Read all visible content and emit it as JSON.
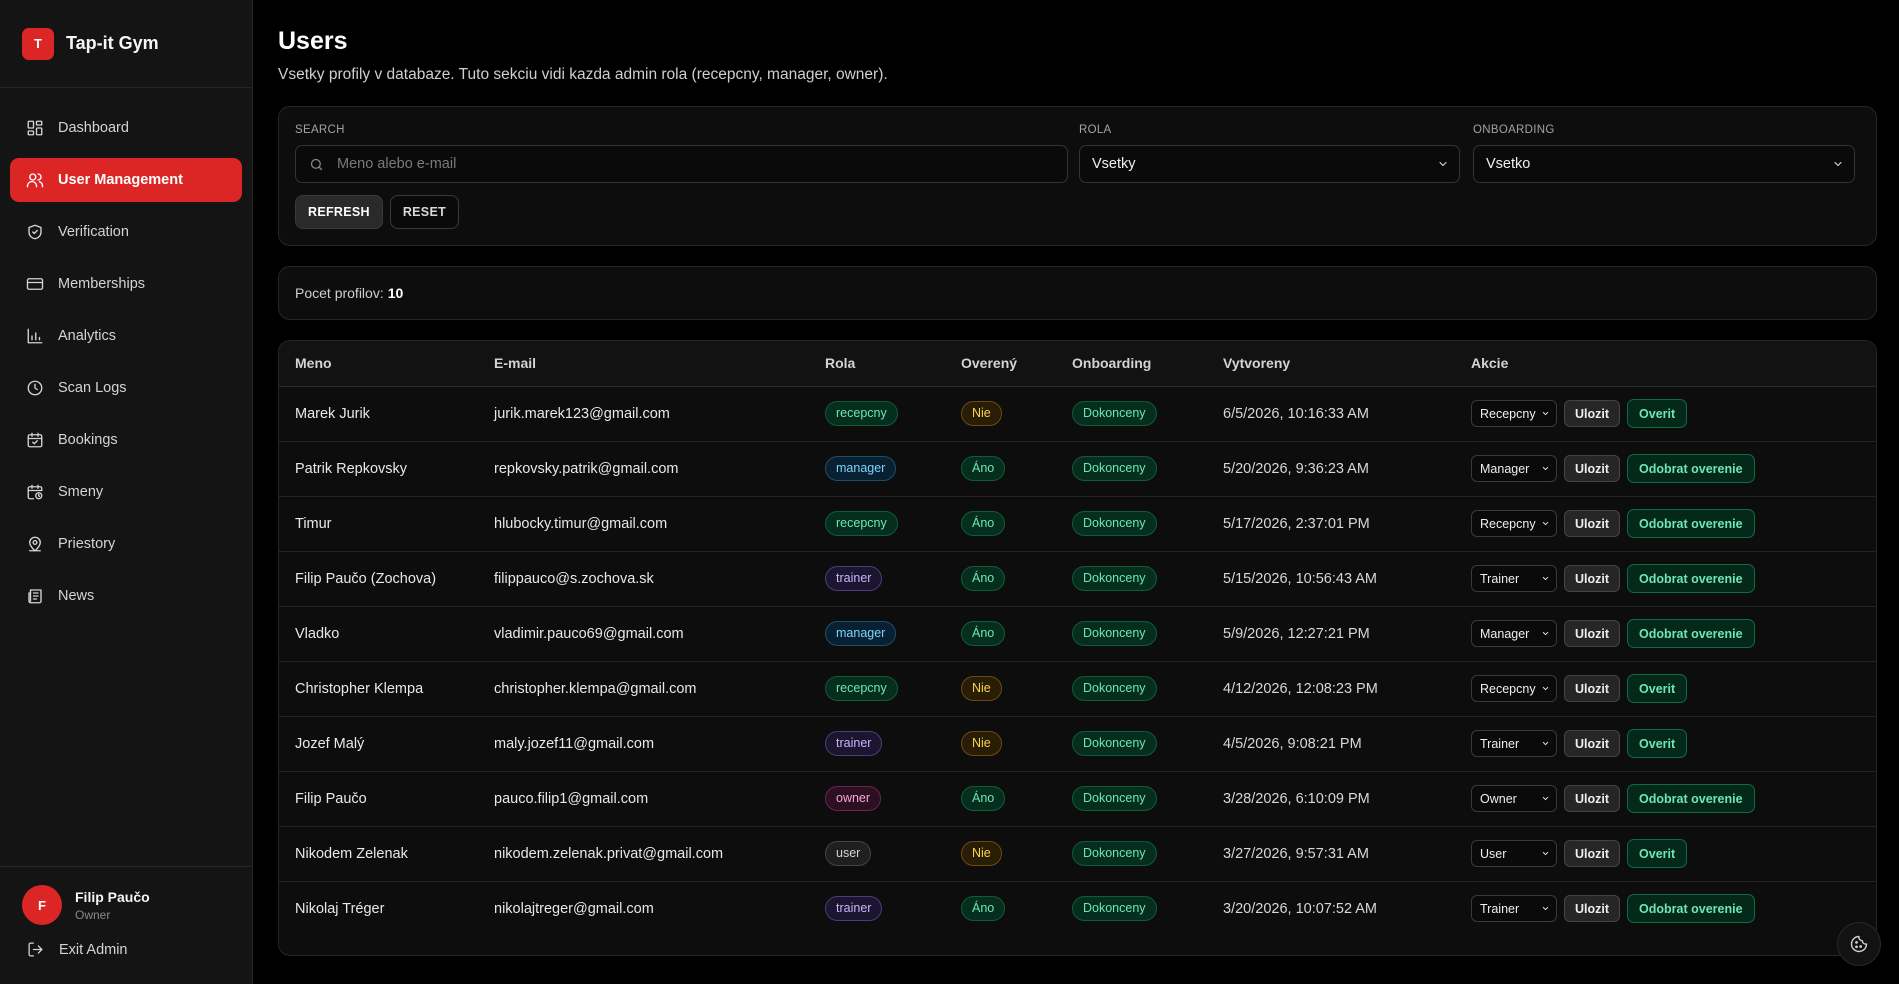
{
  "brand": {
    "logo_letter": "T",
    "name": "Tap-it Gym"
  },
  "sidebar": {
    "items": [
      {
        "label": "Dashboard",
        "icon": "dashboard-icon",
        "active": false
      },
      {
        "label": "User Management",
        "icon": "users-icon",
        "active": true
      },
      {
        "label": "Verification",
        "icon": "shield-check-icon",
        "active": false
      },
      {
        "label": "Memberships",
        "icon": "credit-card-icon",
        "active": false
      },
      {
        "label": "Analytics",
        "icon": "bar-chart-icon",
        "active": false
      },
      {
        "label": "Scan Logs",
        "icon": "clock-icon",
        "active": false
      },
      {
        "label": "Bookings",
        "icon": "calendar-icon",
        "active": false
      },
      {
        "label": "Smeny",
        "icon": "calendar-clock-icon",
        "active": false
      },
      {
        "label": "Priestory",
        "icon": "map-pin-icon",
        "active": false
      },
      {
        "label": "News",
        "icon": "newspaper-icon",
        "active": false
      }
    ],
    "user": {
      "avatar_letter": "F",
      "name": "Filip Paučo",
      "role": "Owner"
    },
    "exit_label": "Exit Admin"
  },
  "header": {
    "title": "Users",
    "subtitle": "Vsetky profily v databaze. Tuto sekciu vidi kazda admin rola (recepcny, manager, owner)."
  },
  "filters": {
    "search_label": "SEARCH",
    "search_placeholder": "Meno alebo e-mail",
    "search_value": "",
    "role_label": "ROLA",
    "role_value": "Vsetky",
    "onboarding_label": "ONBOARDING",
    "onboarding_value": "Vsetko",
    "refresh_label": "REFRESH",
    "reset_label": "RESET"
  },
  "count": {
    "label": "Pocet profilov:",
    "value": "10"
  },
  "table": {
    "columns": [
      "Meno",
      "E-mail",
      "Rola",
      "Overený",
      "Onboarding",
      "Vytvoreny",
      "Akcie"
    ],
    "save_label": "Ulozit",
    "rows": [
      {
        "name": "Marek Jurik",
        "email": "jurik.marek123@gmail.com",
        "role": "recepcny",
        "verified": "Nie",
        "onboarding": "Dokonceny",
        "created": "6/5/2026, 10:16:33 AM",
        "role_select": "Recepcny",
        "action": "Overit"
      },
      {
        "name": "Patrik Repkovsky",
        "email": "repkovsky.patrik@gmail.com",
        "role": "manager",
        "verified": "Áno",
        "onboarding": "Dokonceny",
        "created": "5/20/2026, 9:36:23 AM",
        "role_select": "Manager",
        "action": "Odobrat overenie"
      },
      {
        "name": "Timur",
        "email": "hlubocky.timur@gmail.com",
        "role": "recepcny",
        "verified": "Áno",
        "onboarding": "Dokonceny",
        "created": "5/17/2026, 2:37:01 PM",
        "role_select": "Recepcny",
        "action": "Odobrat overenie"
      },
      {
        "name": "Filip Paučo (Zochova)",
        "email": "filippauco@s.zochova.sk",
        "role": "trainer",
        "verified": "Áno",
        "onboarding": "Dokonceny",
        "created": "5/15/2026, 10:56:43 AM",
        "role_select": "Trainer",
        "action": "Odobrat overenie"
      },
      {
        "name": "Vladko",
        "email": "vladimir.pauco69@gmail.com",
        "role": "manager",
        "verified": "Áno",
        "onboarding": "Dokonceny",
        "created": "5/9/2026, 12:27:21 PM",
        "role_select": "Manager",
        "action": "Odobrat overenie"
      },
      {
        "name": "Christopher Klempa",
        "email": "christopher.klempa@gmail.com",
        "role": "recepcny",
        "verified": "Nie",
        "onboarding": "Dokonceny",
        "created": "4/12/2026, 12:08:23 PM",
        "role_select": "Recepcny",
        "action": "Overit"
      },
      {
        "name": "Jozef Malý",
        "email": "maly.jozef11@gmail.com",
        "role": "trainer",
        "verified": "Nie",
        "onboarding": "Dokonceny",
        "created": "4/5/2026, 9:08:21 PM",
        "role_select": "Trainer",
        "action": "Overit"
      },
      {
        "name": "Filip Paučo",
        "email": "pauco.filip1@gmail.com",
        "role": "owner",
        "verified": "Áno",
        "onboarding": "Dokonceny",
        "created": "3/28/2026, 6:10:09 PM",
        "role_select": "Owner",
        "action": "Odobrat overenie"
      },
      {
        "name": "Nikodem Zelenak",
        "email": "nikodem.zelenak.privat@gmail.com",
        "role": "user",
        "verified": "Nie",
        "onboarding": "Dokonceny",
        "created": "3/27/2026, 9:57:31 AM",
        "role_select": "User",
        "action": "Overit"
      },
      {
        "name": "Nikolaj Tréger",
        "email": "nikolajtreger@gmail.com",
        "role": "trainer",
        "verified": "Áno",
        "onboarding": "Dokonceny",
        "created": "3/20/2026, 10:07:52 AM",
        "role_select": "Trainer",
        "action": "Odobrat overenie"
      }
    ]
  },
  "colors": {
    "accent": "#dc2626",
    "background": "#000000",
    "surface": "#0d0d0d",
    "success": "#6ee7b7",
    "warning": "#fcd34d"
  }
}
